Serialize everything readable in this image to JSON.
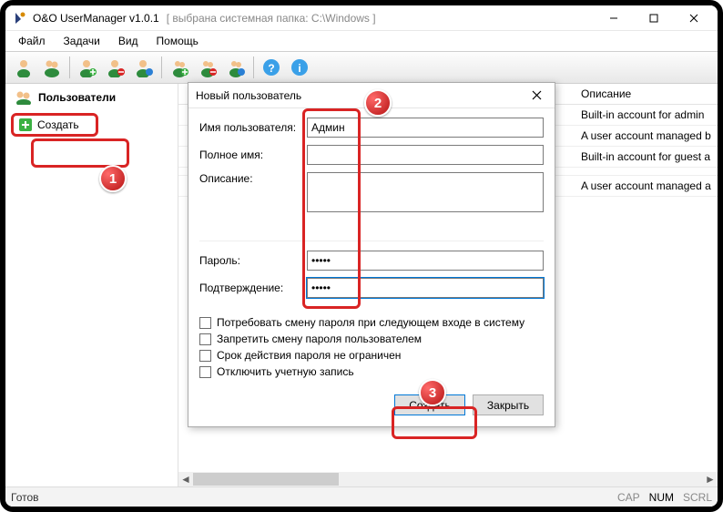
{
  "window": {
    "title": "O&O UserManager v1.0.1",
    "subtitle": "[ выбрана системная папка:  C:\\Windows ]"
  },
  "menubar": [
    "Файл",
    "Задачи",
    "Вид",
    "Помощь"
  ],
  "sidebar": {
    "root_label": "Пользователи",
    "create_label": "Создать"
  },
  "list": {
    "header_desc": "Описание",
    "rows": [
      {
        "desc": "Built-in account for admin"
      },
      {
        "desc": "A user account managed b"
      },
      {
        "desc": "Built-in account for guest a"
      },
      {
        "desc": ""
      },
      {
        "desc": "A user account managed a"
      }
    ]
  },
  "dialog": {
    "title": "Новый пользователь",
    "fields": {
      "username_label": "Имя пользователя:",
      "username_value": "Админ",
      "fullname_label": "Полное имя:",
      "fullname_value": "",
      "description_label": "Описание:",
      "description_value": "",
      "password_label": "Пароль:",
      "password_value": "•••••",
      "confirm_label": "Подтверждение:",
      "confirm_value": "•••••"
    },
    "checkboxes": [
      "Потребовать смену пароля при следующем входе в систему",
      "Запретить смену пароля пользователем",
      "Срок действия пароля не ограничен",
      "Отключить учетную запись"
    ],
    "buttons": {
      "create": "Создать",
      "close": "Закрыть"
    }
  },
  "statusbar": {
    "status": "Готов",
    "indicators": {
      "cap": "CAP",
      "num": "NUM",
      "scrl": "SCRL"
    }
  },
  "annotations": {
    "a1": "1",
    "a2": "2",
    "a3": "3"
  }
}
